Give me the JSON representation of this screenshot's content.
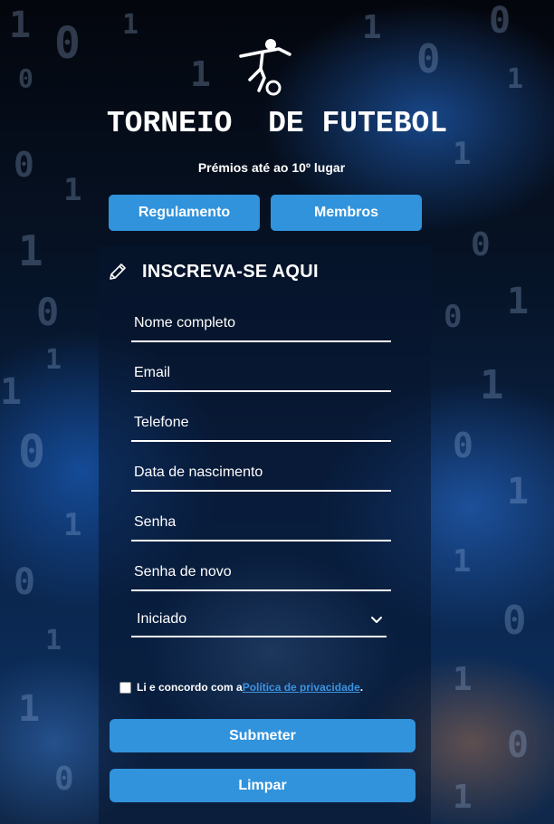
{
  "header": {
    "title": "TORNEIO  DE FUTEBOL",
    "subtitle": "Prémios até ao 10º lugar",
    "logo_icon": "soccer-player-icon"
  },
  "nav": {
    "regulamento_label": "Regulamento",
    "membros_label": "Membros"
  },
  "form": {
    "heading": "INSCREVA-SE AQUI",
    "heading_icon": "pencil-icon",
    "fields": {
      "nome": {
        "placeholder": "Nome completo",
        "value": ""
      },
      "email": {
        "placeholder": "Email",
        "value": ""
      },
      "telefone": {
        "placeholder": "Telefone",
        "value": ""
      },
      "nascimento": {
        "placeholder": "Data de nascimento",
        "value": ""
      },
      "senha": {
        "placeholder": "Senha",
        "value": ""
      },
      "senha_novo": {
        "placeholder": "Senha de novo",
        "value": ""
      }
    },
    "level_select": {
      "selected": "Iniciado",
      "icon": "chevron-down-icon"
    },
    "consent": {
      "prefix": "Li e concordo com a ",
      "link": "Política de privacidade",
      "suffix": ".",
      "checked": false
    },
    "submit_label": "Submeter",
    "clear_label": "Limpar"
  },
  "colors": {
    "button": "#3193dc",
    "link": "#3c93e0",
    "text": "#ffffff"
  }
}
